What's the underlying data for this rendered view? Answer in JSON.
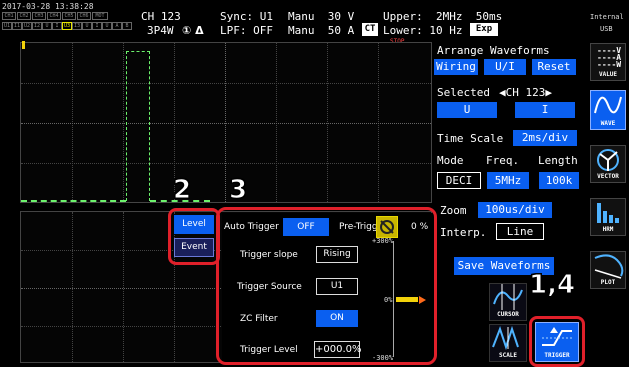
{
  "status": {
    "datetime": "2017-03-28 13:38:28",
    "channel_row1": [
      "CH1",
      "CH2",
      "CH3",
      "CH4",
      "CH5",
      "CH6",
      "MOT"
    ],
    "channel_row2": [
      "U1",
      "I1",
      "U2",
      "I2",
      "U",
      "I",
      "U3",
      "I3",
      "U",
      "I",
      "U",
      "A",
      "B"
    ],
    "ch_label": "CH 123",
    "wiring_label": "3P4W",
    "sync_label": "Sync: U1",
    "lpf_label": "LPF: OFF",
    "range_v": "Manu  30 V",
    "range_a": "Manu  50 A",
    "ct_badge": "CT",
    "upper": "Upper:  2MHz  50ms",
    "lower": "Lower: 10 Hz",
    "exp_badge": "Exp",
    "stop": "STOP",
    "internal": "Internal",
    "usb": "USB",
    "channel_mark": "① Δ"
  },
  "arrange": {
    "title": "Arrange Waveforms",
    "wiring": "Wiring",
    "ui": "U/I",
    "reset": "Reset",
    "selected_label": "Selected",
    "selected_value": "◀CH 123▶",
    "u": "U",
    "i": "I",
    "time_scale_label": "Time Scale",
    "time_scale_value": "2ms/div",
    "mode_label": "Mode",
    "freq_label": "Freq.",
    "length_label": "Length",
    "mode_value": "DECI",
    "freq_value": "5MHz",
    "length_value": "100k",
    "zoom_label": "Zoom",
    "zoom_value": "100us/div",
    "interp_label": "Interp.",
    "interp_value": "Line",
    "save": "Save Waveforms"
  },
  "side": {
    "value": "VALUE",
    "wave": "WAVE",
    "vector": "VECTOR",
    "hrm": "HRM",
    "plot": "PLOT"
  },
  "tools": {
    "cursor": "CURSOR",
    "scale": "SCALE",
    "trigger": "TRIGGER"
  },
  "level_event": {
    "level": "Level",
    "event": "Event"
  },
  "trigger": {
    "auto_label": "Auto Trigger",
    "auto_value": "OFF",
    "pretrigger_label": "Pre-Trigger",
    "pretrigger_value": "0 %",
    "slope_label": "Trigger slope",
    "slope_value": "Rising",
    "source_label": "Trigger Source",
    "source_value": "U1",
    "zc_label": "ZC Filter",
    "zc_value": "ON",
    "level_label": "Trigger Level",
    "level_value": "+000.0%",
    "scale_top": "+300%",
    "scale_mid": "0%",
    "scale_bottom": "-300%"
  },
  "callouts": {
    "n2": "2",
    "n3": "3",
    "n14": "1,4"
  },
  "colors": {
    "accent_blue": "#0a5ff0",
    "callout_red": "#e0202a",
    "waveform_green": "#6cf26c",
    "trigger_yellow": "#f2d20a",
    "status_orange": "#ff6a1a"
  }
}
